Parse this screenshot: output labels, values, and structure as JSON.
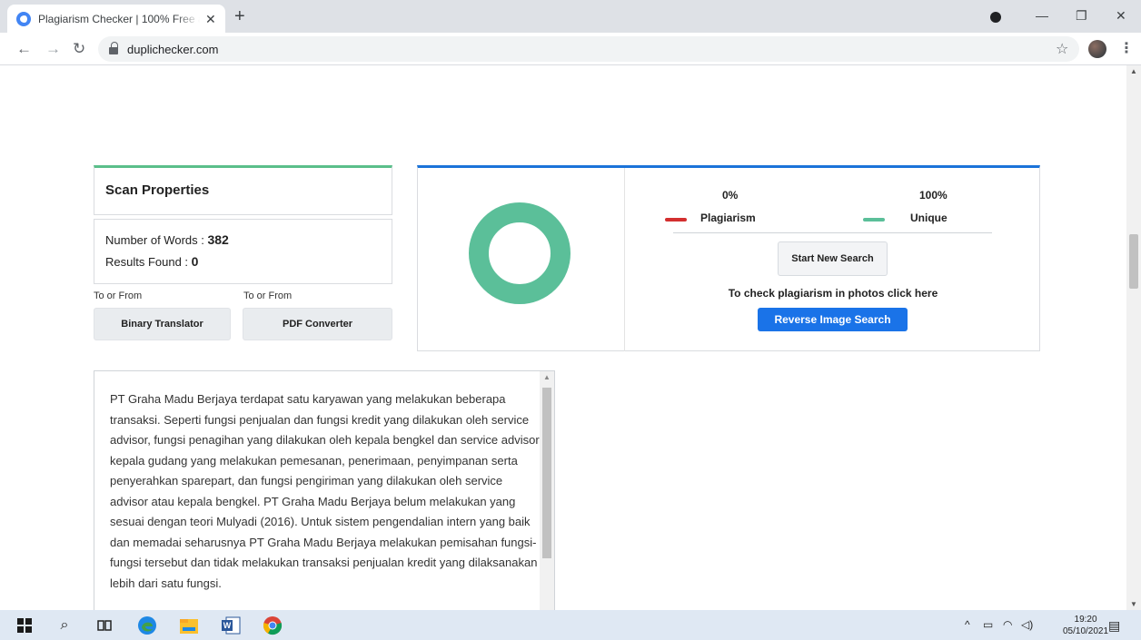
{
  "browser": {
    "tab_title": "Plagiarism Checker | 100% Free a",
    "url": "duplichecker.com",
    "icons": [
      "google-g-icon",
      "close-icon",
      "plus-icon",
      "back-arrow-icon",
      "forward-arrow-icon",
      "reload-icon",
      "lock-icon",
      "star-icon",
      "kebab-menu-icon"
    ]
  },
  "scan": {
    "title": "Scan Properties",
    "words_label": "Number of Words : ",
    "words_value": "382",
    "results_label": "Results Found : ",
    "results_value": "0"
  },
  "links": {
    "to_from_1": "To or From",
    "to_from_2": "To or From",
    "binary_btn": "Binary Translator",
    "pdf_btn": "PDF Converter"
  },
  "result": {
    "plag_pct": "0%",
    "unique_pct": "100%",
    "plag_label": "Plagiarism",
    "unique_label": "Unique",
    "plag_fraction": 0,
    "unique_fraction": 1,
    "start_btn": "Start New Search",
    "photo_text": "To check plagiarism in photos click here",
    "reverse_btn": "Reverse Image Search",
    "colors": {
      "plagiarism": "#d32f2f",
      "unique": "#5bbf99",
      "accent": "#1a73e8"
    }
  },
  "content": {
    "text": "PT Graha Madu Berjaya terdapat satu karyawan yang melakukan beberapa transaksi. Seperti fungsi penjualan dan fungsi kredit yang dilakukan oleh service advisor, fungsi penagihan yang dilakukan oleh kepala bengkel dan service advisor, kepala gudang yang melakukan pemesanan, penerimaan, penyimpanan serta penyerahkan sparepart, dan fungsi pengiriman yang dilakukan oleh service advisor atau kepala bengkel. PT Graha Madu Berjaya belum melakukan yang sesuai dengan teori Mulyadi (2016). Untuk sistem pengendalian intern yang baik dan memadai seharusnya PT Graha Madu Berjaya melakukan pemisahan fungsi-fungsi tersebut dan tidak melakukan transaksi penjualan kredit yang dilaksanakan lebih dari satu fungsi."
  },
  "taskbar": {
    "time": "19:20",
    "date": "05/10/2021",
    "icons": [
      "windows-start-icon",
      "search-icon",
      "task-view-icon",
      "edge-icon",
      "file-explorer-icon",
      "word-icon",
      "chrome-icon"
    ]
  }
}
